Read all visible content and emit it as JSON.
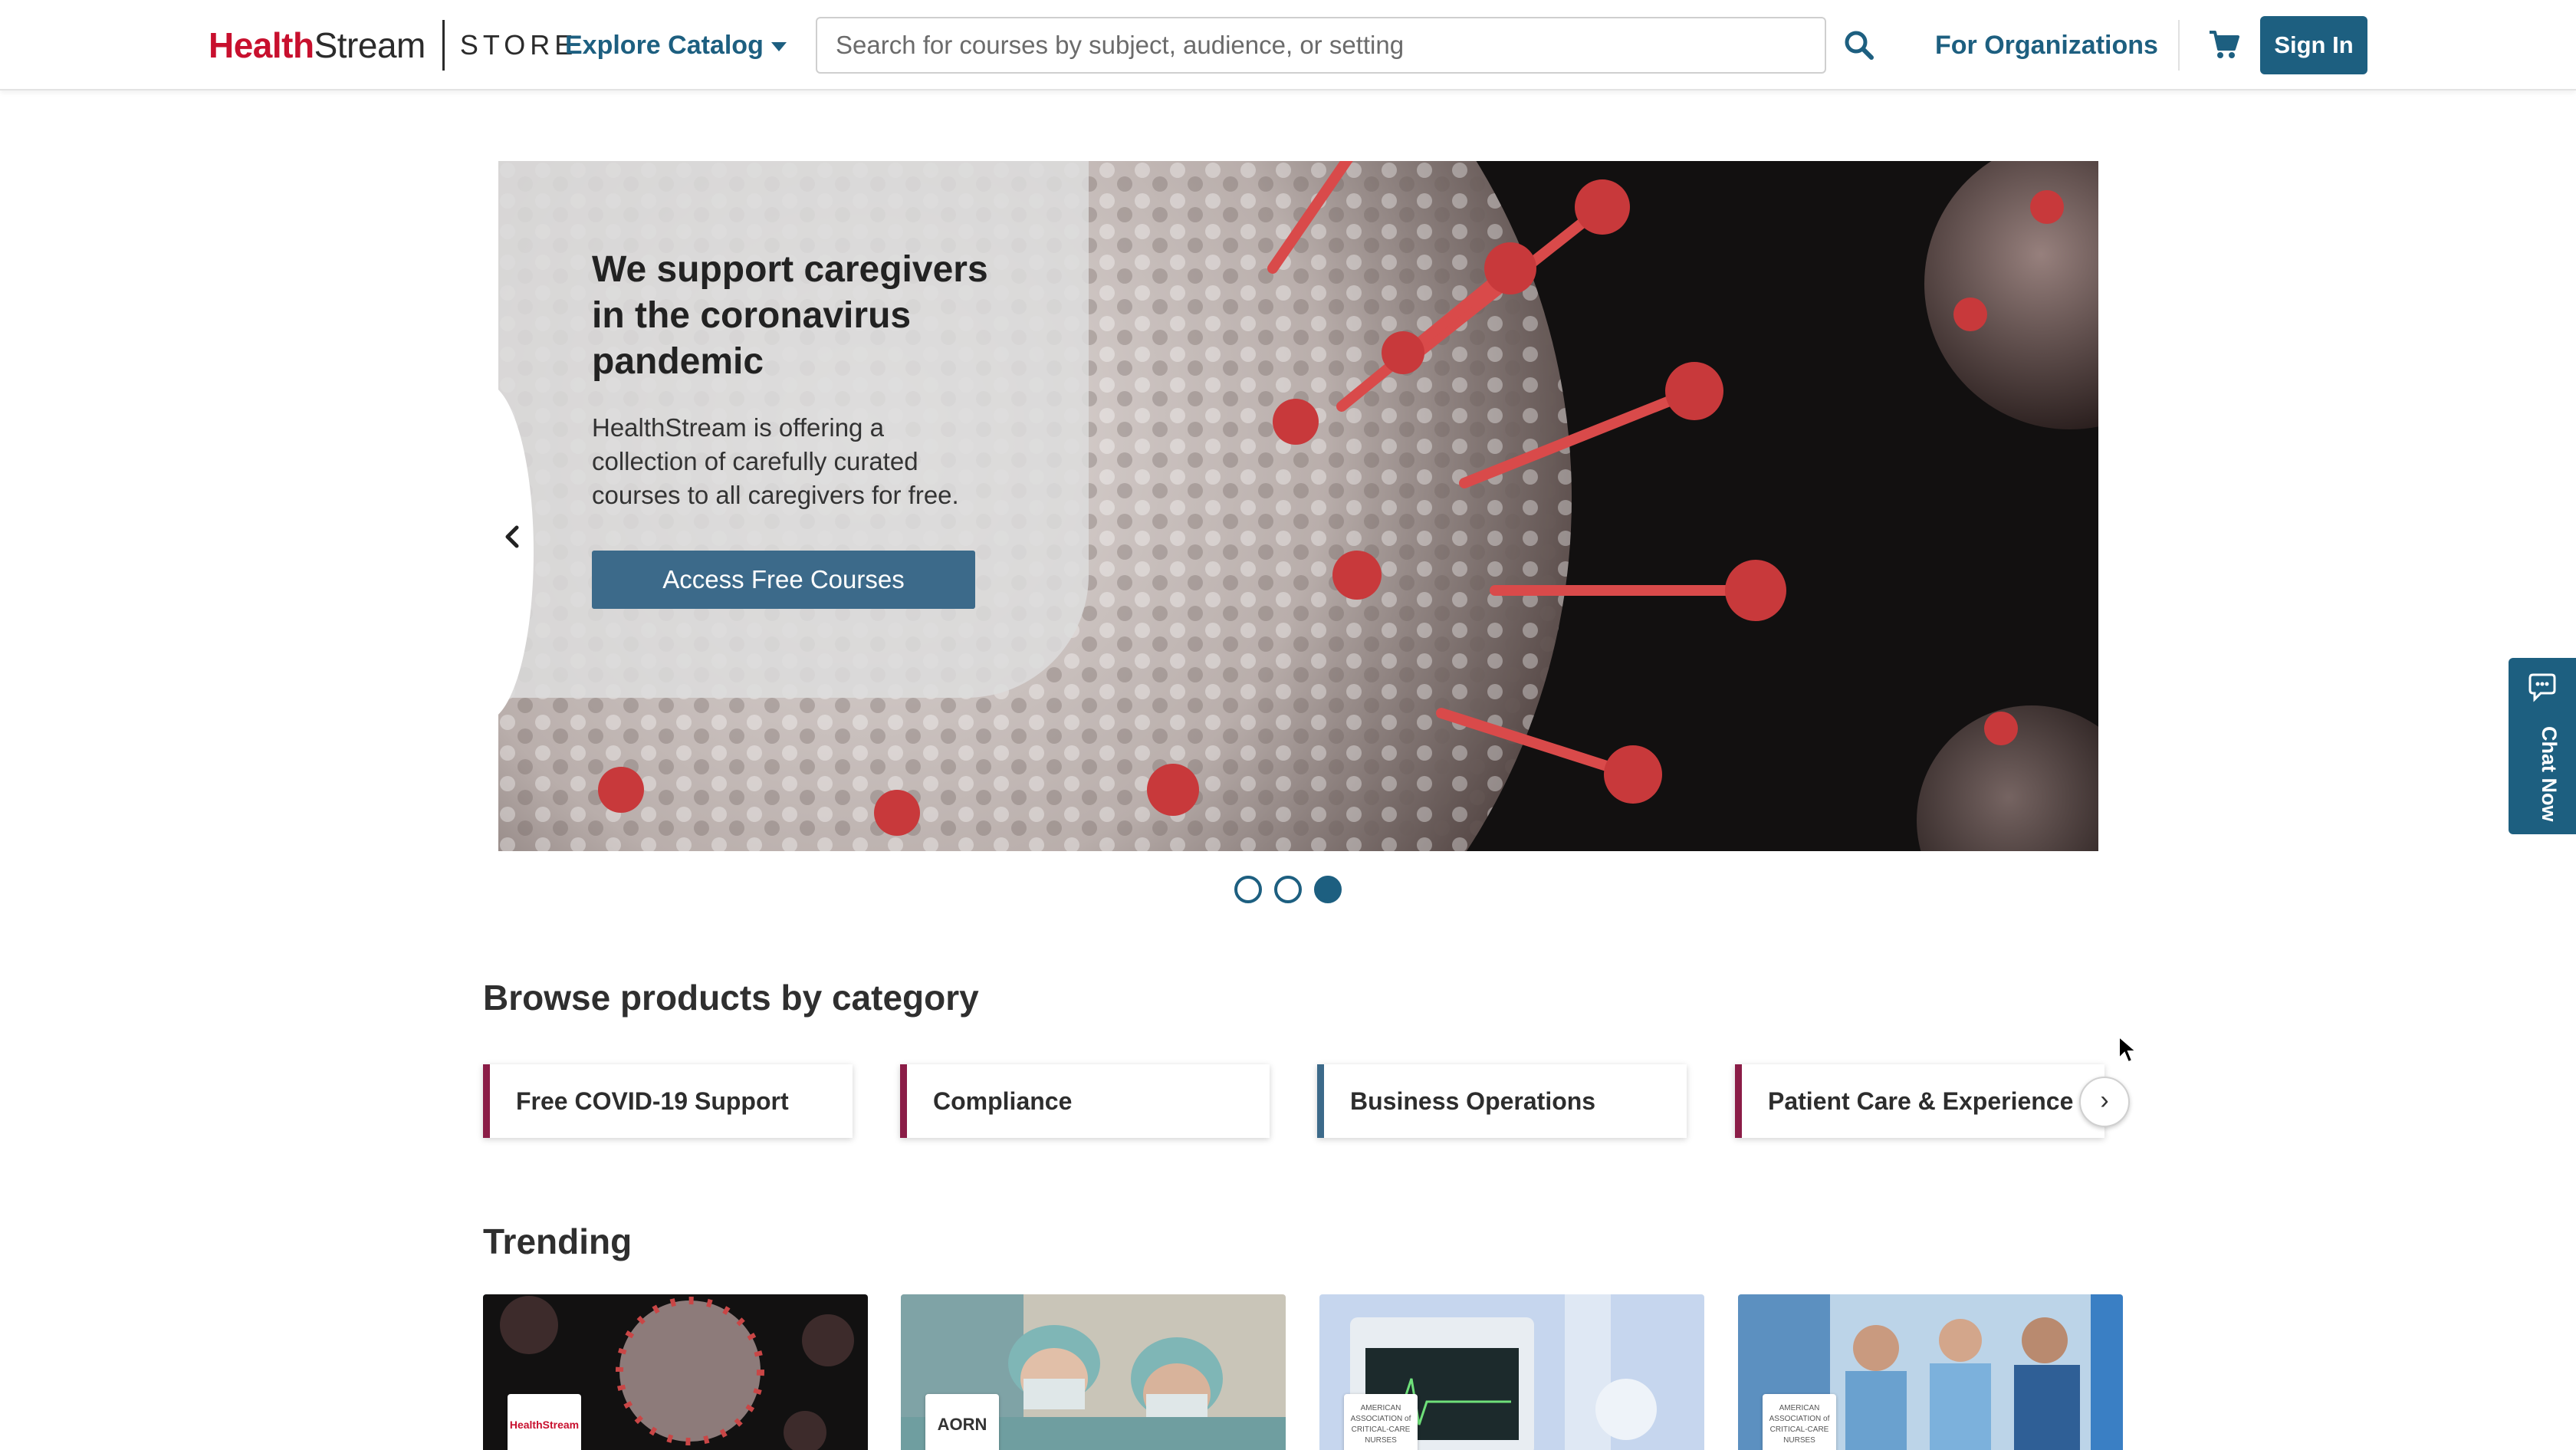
{
  "header": {
    "logo_health": "Health",
    "logo_stream": "Stream",
    "logo_store": "STORE",
    "explore_label": "Explore Catalog",
    "search_placeholder": "Search for courses by subject, audience, or setting",
    "for_org_label": "For Organizations",
    "signin_label": "Sign In"
  },
  "hero": {
    "title": "We support caregivers in the coronavirus pandemic",
    "text": "HealthStream is offering a collection of carefully curated courses to all caregivers for free.",
    "cta_label": "Access Free Courses",
    "slide_count": 3,
    "active_slide": 3
  },
  "chat": {
    "label": "Chat Now"
  },
  "categories": {
    "title": "Browse products by category",
    "items": [
      {
        "label": "Free COVID-19 Support",
        "accent": "#8b1d47"
      },
      {
        "label": "Compliance",
        "accent": "#8b1d47"
      },
      {
        "label": "Business Operations",
        "accent": "#3c6a8a"
      },
      {
        "label": "Patient Care & Experience",
        "accent": "#8b1d47"
      }
    ],
    "next_label": "›"
  },
  "trending": {
    "title": "Trending",
    "items": [
      {
        "publisher": "HealthStream",
        "image": "coronavirus"
      },
      {
        "publisher": "AORN",
        "image": "surgeons"
      },
      {
        "publisher": "AMERICAN ASSOCIATION of CRITICAL-CARE NURSES",
        "image": "patient-monitor"
      },
      {
        "publisher": "AMERICAN ASSOCIATION of CRITICAL-CARE NURSES",
        "image": "nurses"
      }
    ]
  },
  "colors": {
    "brand_red": "#c8102e",
    "primary_blue": "#1d5f80",
    "cta_blue": "#3c6a8a",
    "category_accent": "#8b1d47"
  },
  "icons": {
    "search": "search-icon",
    "cart": "cart-icon",
    "chat": "chat-icon",
    "prev": "chevron-left-icon",
    "next": "chevron-right-icon"
  }
}
